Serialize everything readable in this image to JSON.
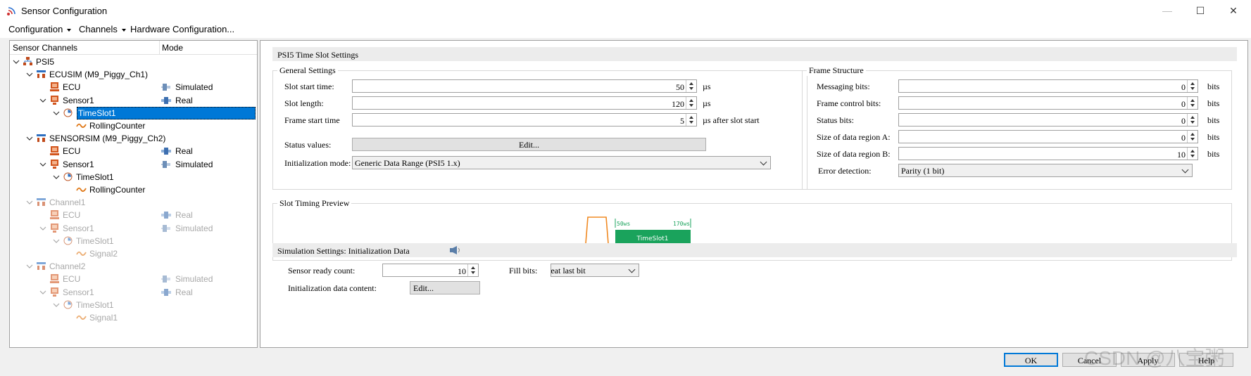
{
  "window": {
    "title": "Sensor Configuration",
    "minimize_glyph": "—",
    "maximize_glyph": "☐",
    "close_glyph": "✕"
  },
  "menu": {
    "items": [
      "Configuration",
      "Channels",
      "Hardware Configuration..."
    ]
  },
  "tree": {
    "col_channels": "Sensor Channels",
    "col_mode": "Mode",
    "nodes": [
      {
        "label": "PSI5",
        "mode": "",
        "icon": "network-icon",
        "expanded": true,
        "disabled": false
      },
      {
        "label": "ECUSIM (M9_Piggy_Ch1)",
        "mode": "",
        "icon": "channel-icon",
        "expanded": true,
        "disabled": false
      },
      {
        "label": "ECU",
        "mode": "Simulated",
        "icon": "ecu-icon",
        "disabled": false
      },
      {
        "label": "Sensor1",
        "mode": "Real",
        "icon": "sensor-icon",
        "expanded": true,
        "disabled": false
      },
      {
        "label": "TimeSlot1",
        "mode": "",
        "icon": "timeslot-icon",
        "expanded": true,
        "selected": true,
        "disabled": false
      },
      {
        "label": "RollingCounter",
        "mode": "",
        "icon": "signal-icon",
        "disabled": false
      },
      {
        "label": "SENSORSIM (M9_Piggy_Ch2)",
        "mode": "",
        "icon": "channel-icon",
        "expanded": true,
        "disabled": false
      },
      {
        "label": "ECU",
        "mode": "Real",
        "icon": "ecu-icon",
        "disabled": false
      },
      {
        "label": "Sensor1",
        "mode": "Simulated",
        "icon": "sensor-icon",
        "expanded": true,
        "disabled": false
      },
      {
        "label": "TimeSlot1",
        "mode": "",
        "icon": "timeslot-icon",
        "expanded": true,
        "disabled": false
      },
      {
        "label": "RollingCounter",
        "mode": "",
        "icon": "signal-icon",
        "disabled": false
      },
      {
        "label": "Channel1",
        "mode": "",
        "icon": "channel-icon",
        "expanded": true,
        "disabled": true
      },
      {
        "label": "ECU",
        "mode": "Real",
        "icon": "ecu-icon",
        "disabled": true
      },
      {
        "label": "Sensor1",
        "mode": "Simulated",
        "icon": "sensor-icon",
        "expanded": true,
        "disabled": true
      },
      {
        "label": "TimeSlot1",
        "mode": "",
        "icon": "timeslot-icon",
        "expanded": true,
        "disabled": true
      },
      {
        "label": "Signal2",
        "mode": "",
        "icon": "signal-icon",
        "disabled": true
      },
      {
        "label": "Channel2",
        "mode": "",
        "icon": "channel-icon",
        "expanded": true,
        "disabled": true
      },
      {
        "label": "ECU",
        "mode": "Simulated",
        "icon": "ecu-icon",
        "disabled": true
      },
      {
        "label": "Sensor1",
        "mode": "Real",
        "icon": "sensor-icon",
        "expanded": true,
        "disabled": true
      },
      {
        "label": "TimeSlot1",
        "mode": "",
        "icon": "timeslot-icon",
        "expanded": true,
        "disabled": true
      },
      {
        "label": "Signal1",
        "mode": "",
        "icon": "signal-icon",
        "disabled": true
      }
    ]
  },
  "psi5": {
    "section_title": "PSI5 Time Slot Settings",
    "general": {
      "title": "General Settings",
      "slot_start_label": "Slot start time:",
      "slot_start_value": "50",
      "slot_start_unit": "µs",
      "slot_length_label": "Slot length:",
      "slot_length_value": "120",
      "slot_length_unit": "µs",
      "frame_start_label": "Frame start time",
      "frame_start_value": "5",
      "frame_start_unit": "µs after slot start",
      "status_values_label": "Status values:",
      "status_values_button": "Edit...",
      "init_mode_label": "Initialization mode:",
      "init_mode_value": "Generic Data Range (PSI5 1.x)"
    },
    "frame": {
      "title": "Frame Structure",
      "messaging_label": "Messaging bits:",
      "messaging_value": "0",
      "frame_control_label": "Frame control bits:",
      "frame_control_value": "0",
      "status_label": "Status bits:",
      "status_value": "0",
      "data_region_a_label": "Size of data region A:",
      "data_region_a_value": "0",
      "data_region_b_label": "Size of data region B:",
      "data_region_b_value": "10",
      "bits_unit": "bits",
      "error_detection_label": "Error detection:",
      "error_detection_value": "Parity (1 bit)"
    },
    "preview": {
      "title": "Slot Timing Preview",
      "start_marker": "50ws",
      "end_marker": "170ws",
      "slot_label": "TimeSlot1",
      "slot_color": "#1aa35c",
      "pulse_color": "#f08a24"
    }
  },
  "simulation": {
    "section_title": "Simulation Settings: Initialization Data",
    "ready_count_label": "Sensor ready count:",
    "ready_count_value": "10",
    "fill_bits_label": "Fill bits:",
    "fill_bits_value": "Repeat last bit",
    "init_data_label": "Initialization data content:",
    "init_data_button": "Edit..."
  },
  "footer": {
    "ok": "OK",
    "cancel": "Cancel",
    "apply": "Apply",
    "help": "Help"
  },
  "watermark": "CSDN @八宝粥"
}
